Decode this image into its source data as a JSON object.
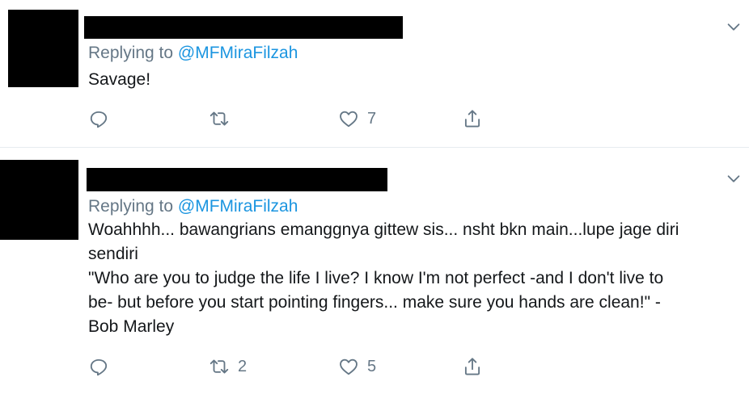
{
  "tweets": [
    {
      "replying_prefix": "Replying to ",
      "replying_handle": "@MFMiraFilzah",
      "text_lines": [
        "Savage!"
      ],
      "retweets": "",
      "likes": "7"
    },
    {
      "replying_prefix": "Replying to ",
      "replying_handle": "@MFMiraFilzah",
      "text_lines": [
        "Woahhhh... bawangrians emanggnya gittew sis... nsht bkn main...lupe jage diri",
        "sendiri",
        "\"Who are you to judge the life I live? I know I'm not perfect -and I don't live to",
        "be- but before you start pointing fingers... make sure you hands are clean!\" -",
        "Bob Marley"
      ],
      "retweets": "2",
      "likes": "5"
    }
  ],
  "icons": {
    "more": "chevron-down-icon",
    "reply": "reply-icon",
    "retweet": "retweet-icon",
    "like": "heart-icon",
    "share": "share-icon"
  },
  "colors": {
    "text": "#14171a",
    "secondary": "#657786",
    "link": "#1b95e0",
    "divider": "#e6ecf0",
    "redaction": "#000000"
  }
}
